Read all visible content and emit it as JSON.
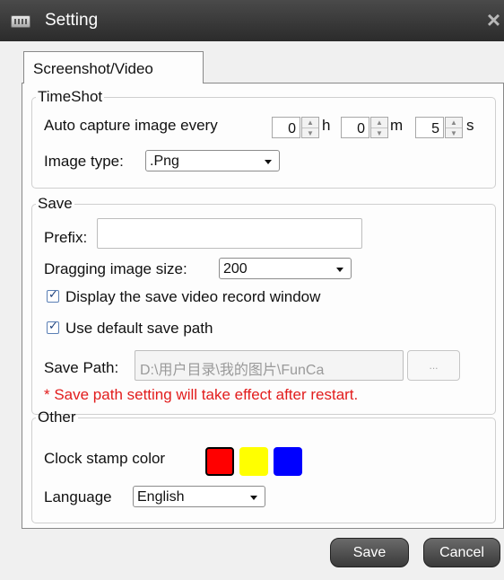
{
  "window": {
    "title": "Setting",
    "close_glyph": "×",
    "icon": "settings-window-icon"
  },
  "tabs": [
    {
      "label": "Screenshot/Video",
      "selected": true
    }
  ],
  "timeshot": {
    "legend": "TimeShot",
    "auto_capture_label": "Auto capture image every",
    "hours": {
      "value": "0",
      "unit": "h"
    },
    "minutes": {
      "value": "0",
      "unit": "m"
    },
    "seconds": {
      "value": "5",
      "unit": "s"
    },
    "image_type_label": "Image type:",
    "image_type_value": ".Png"
  },
  "save": {
    "legend": "Save",
    "prefix_label": "Prefix:",
    "prefix_value": "",
    "dragging_size_label": "Dragging image size:",
    "dragging_size_value": "200",
    "display_window_checkbox": {
      "label": "Display the save video  record window",
      "checked": true
    },
    "default_path_checkbox": {
      "label": "Use default save path",
      "checked": true
    },
    "save_path_label": "Save Path:",
    "save_path_value": "D:\\用户目录\\我的图片\\FunCa",
    "browse_label": "...",
    "warning": "* Save path setting will take effect after restart."
  },
  "other": {
    "legend": "Other",
    "clock_color_label": "Clock stamp color",
    "colors": [
      "#ff0000",
      "#ffff00",
      "#0000ff"
    ],
    "selected_color": "#ff0000",
    "language_label": "Language",
    "language_value": "English"
  },
  "footer": {
    "save_label": "Save",
    "cancel_label": "Cancel"
  },
  "icons": {
    "spin_up": "▲",
    "spin_down": "▼",
    "check": "✓"
  }
}
